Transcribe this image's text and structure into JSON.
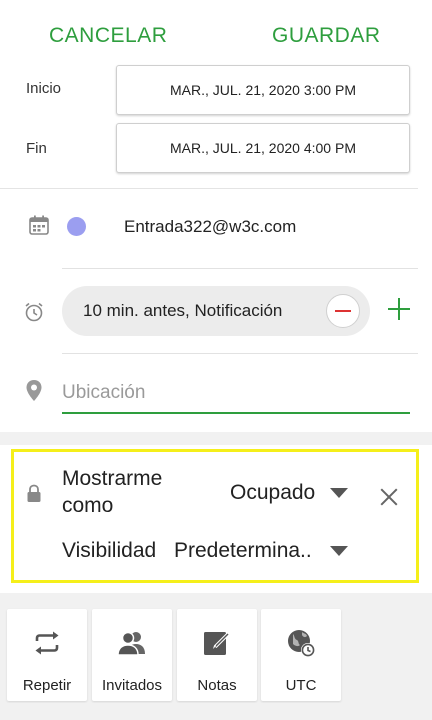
{
  "header": {
    "cancel_label": "CANCELAR",
    "save_label": "GUARDAR"
  },
  "start": {
    "label": "Inicio",
    "value": "MAR., JUL. 21, 2020  3:00 PM"
  },
  "end": {
    "label": "Fin",
    "value": "MAR., JUL. 21, 2020  4:00 PM"
  },
  "calendar": {
    "account": "Entrada322@w3c.com",
    "color": "#9b9ef0"
  },
  "reminder": {
    "text": "10 min. antes, Notificación"
  },
  "location": {
    "placeholder": "Ubicación",
    "value": ""
  },
  "privacy": {
    "show_as_label": "Mostrarme como",
    "show_as_value": "Ocupado",
    "visibility_label": "Visibilidad",
    "visibility_value": "Predetermina.."
  },
  "tools": [
    {
      "label": "Repetir",
      "icon": "repeat-icon"
    },
    {
      "label": "Invitados",
      "icon": "guests-icon"
    },
    {
      "label": "Notas",
      "icon": "notes-icon"
    },
    {
      "label": "UTC",
      "icon": "timezone-icon"
    }
  ],
  "colors": {
    "accent": "#2e9e3e",
    "highlight": "#f5ef1a"
  }
}
